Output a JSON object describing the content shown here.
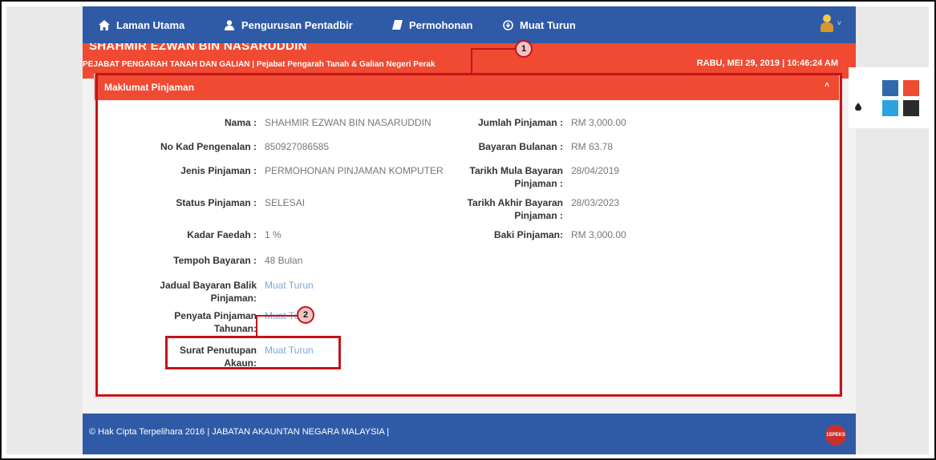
{
  "nav": {
    "items": [
      {
        "label": "Laman Utama",
        "icon": "home-icon"
      },
      {
        "label": "Pengurusan Pentadbir",
        "icon": "user-icon"
      },
      {
        "label": "Permohonan",
        "icon": "book-icon"
      },
      {
        "label": "Muat Turun",
        "icon": "download-circle-icon"
      }
    ],
    "caret": "˅"
  },
  "header": {
    "user_name": "SHAHMIR EZWAN BIN NASARUDDIN",
    "office": "PEJABAT PENGARAH TANAH DAN GALIAN | Pejabat Pengarah Tanah & Galian Negeri Perak",
    "datetime": "RABU, MEI 29, 2019 | 10:46:24 AM"
  },
  "panel": {
    "title": "Maklumat Pinjaman",
    "collapse_glyph": "˄",
    "left": {
      "nama_label": "Nama :",
      "nama_value": "SHAHMIR EZWAN BIN NASARUDDIN",
      "kad_label": "No Kad Pengenalan :",
      "kad_value": "850927086585",
      "jenis_label": "Jenis Pinjaman :",
      "jenis_value": "PERMOHONAN PINJAMAN KOMPUTER",
      "status_label": "Status Pinjaman :",
      "status_value": "SELESAI",
      "kadar_label": "Kadar Faedah :",
      "kadar_value": "1 %",
      "tempoh_label": "Tempoh Bayaran :",
      "tempoh_value": "48 Bulan",
      "jadual_label_1": "Jadual Bayaran Balik",
      "jadual_label_2": "Pinjaman:",
      "jadual_link": "Muat Turun",
      "penyata_label_1": "Penyata Pinjaman",
      "penyata_label_2": "Tahunan:",
      "penyata_link": "Muat Turun",
      "surat_label_1": "Surat Penutupan",
      "surat_label_2": "Akaun:",
      "surat_link": "Muat Turun"
    },
    "right": {
      "jumlah_label": "Jumlah Pinjaman :",
      "jumlah_value": "RM 3,000.00",
      "bulanan_label": "Bayaran Bulanan :",
      "bulanan_value": "RM 63.78",
      "mula_label_1": "Tarikh Mula Bayaran",
      "mula_label_2": "Pinjaman :",
      "mula_value": "28/04/2019",
      "akhir_label_1": "Tarikh Akhir Bayaran",
      "akhir_label_2": "Pinjaman :",
      "akhir_value": "28/03/2023",
      "baki_label": "Baki Pinjaman:",
      "baki_value": "RM 3,000.00"
    }
  },
  "callouts": {
    "one": "1",
    "two": "2"
  },
  "footer": {
    "text": "© Hak Cipta Terpelihara 2016 | JABATAN AKAUNTAN NEGARA MALAYSIA |",
    "logo_text": "1SPEKS"
  },
  "theme": {
    "swatches": [
      "#2f6aab",
      "#f04a32",
      "#2aa3de",
      "#2b2b2b"
    ]
  }
}
